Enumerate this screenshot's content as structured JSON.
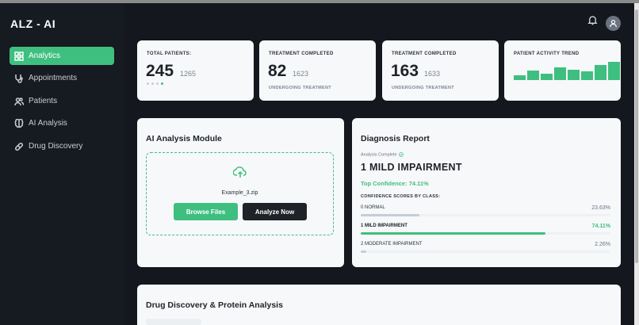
{
  "app": {
    "title": "ALZ - AI"
  },
  "sidebar": {
    "items": [
      {
        "label": "Analytics",
        "icon": "grid-icon",
        "active": true
      },
      {
        "label": "Appointments",
        "icon": "stethoscope-icon",
        "active": false
      },
      {
        "label": "Patients",
        "icon": "users-icon",
        "active": false
      },
      {
        "label": "AI Analysis",
        "icon": "brain-icon",
        "active": false
      },
      {
        "label": "Drug Discovery",
        "icon": "pill-icon",
        "active": false
      }
    ]
  },
  "header": {
    "icons": [
      "bell-icon",
      "user-avatar-icon"
    ]
  },
  "stats": [
    {
      "label": "TOTAL PATIENTS:",
      "value": "245",
      "secondary": "1265",
      "sub": ""
    },
    {
      "label": "TREATMENT COMPLETED",
      "value": "82",
      "secondary": "1623",
      "sub": "UNDERGOING TREATMENT"
    },
    {
      "label": "TREATMENT COMPLETED",
      "value": "163",
      "secondary": "1633",
      "sub": "UNDERGOING TREATMENT"
    },
    {
      "label": "PATIENT ACTIVITY TREND",
      "trend": [
        0.25,
        0.5,
        0.35,
        0.65,
        0.55,
        0.45,
        0.8,
        0.95
      ]
    }
  ],
  "analysis": {
    "title": "AI Analysis Module",
    "file_name": "Example_3.zip",
    "browse_label": "Browse Files",
    "analyze_label": "Analyze Now"
  },
  "diagnosis": {
    "title": "Diagnosis Report",
    "status": "Analysis Complete",
    "class": "1 MILD IMPAIRMENT",
    "top_confidence": "Top Confidence: 74.11%",
    "scores_header": "CONFIDENCE SCORES BY CLASS:",
    "scores": [
      {
        "name": "0 NORMAL",
        "value": "23.63%",
        "fraction": 0.2363
      },
      {
        "name": "1 MILD IMPAIRMENT",
        "value": "74.11%",
        "fraction": 0.7411
      },
      {
        "name": "2 MODERATE IMPAIRMENT",
        "value": "2.26%",
        "fraction": 0.0226
      }
    ]
  },
  "drug": {
    "title": "Drug Discovery & Protein Analysis"
  },
  "colors": {
    "accent": "#3fbf7f",
    "sidebar": "#161a21",
    "background": "#14181e"
  }
}
